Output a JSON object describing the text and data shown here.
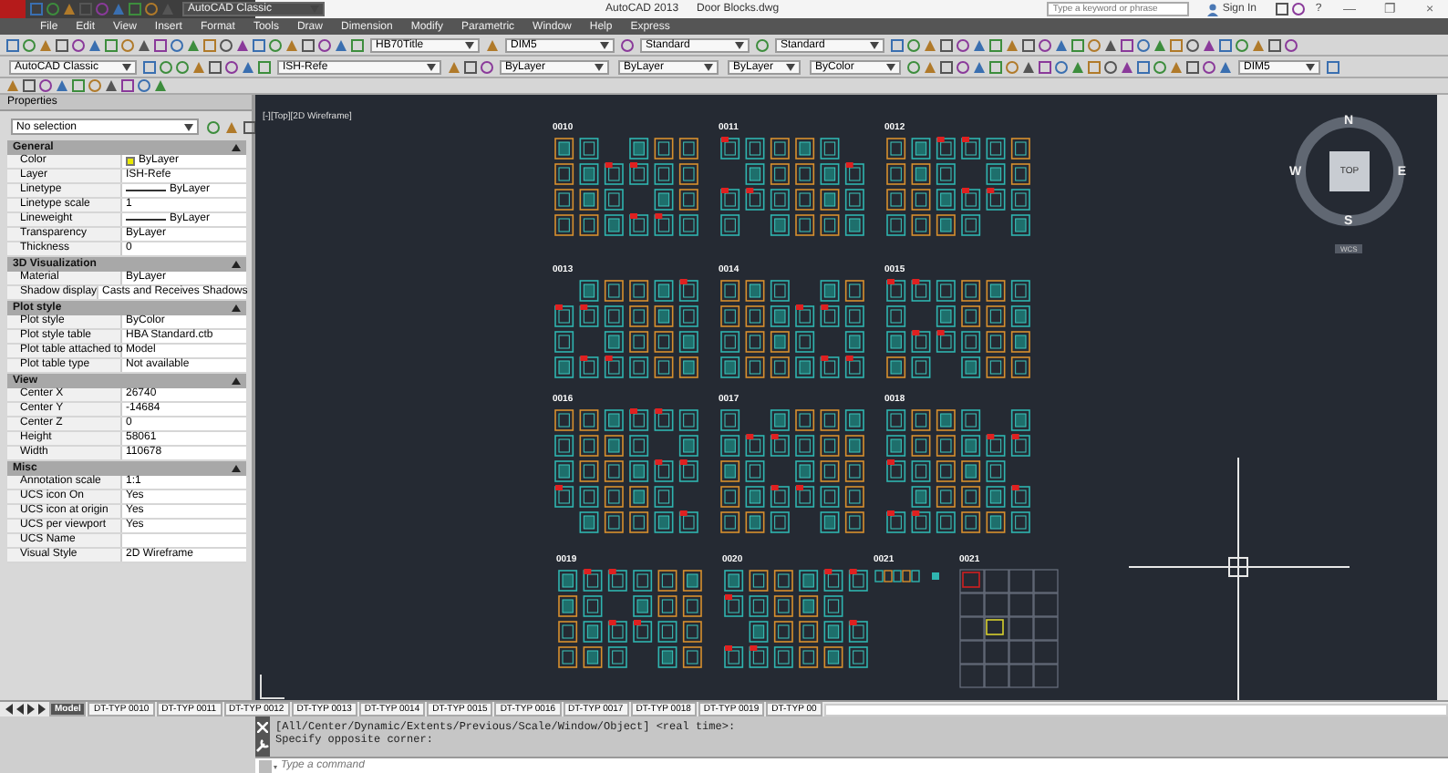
{
  "title_bar": {
    "workspace": "AutoCAD Classic",
    "app_title": "AutoCAD 2013",
    "file_name": "Door Blocks.dwg",
    "search": {
      "placeholder": "Type a keyword or phrase"
    },
    "sign_in": "Sign In",
    "help": "?",
    "window_controls": [
      "—",
      "❐",
      "×"
    ]
  },
  "menu_bar": [
    "File",
    "Edit",
    "View",
    "Insert",
    "Format",
    "Tools",
    "Draw",
    "Dimension",
    "Modify",
    "Parametric",
    "Window",
    "Help",
    "Express"
  ],
  "toolbar_1": {
    "dropdowns": [
      "HB70Title",
      "DIM5",
      "Standard",
      "Standard"
    ]
  },
  "toolbar_2": {
    "dropdowns": [
      "AutoCAD Classic",
      "ISH-Refe",
      "ByLayer",
      "ByLayer",
      "ByLayer",
      "ByColor",
      "DIM5"
    ]
  },
  "properties": {
    "title": "Properties",
    "selection": "No selection",
    "sections": [
      {
        "title": "General",
        "expanded": true,
        "rows": [
          {
            "label": "Color",
            "value": "ByLayer",
            "kind": "color"
          },
          {
            "label": "Layer",
            "value": "ISH-Refe",
            "kind": "text"
          },
          {
            "label": "Linetype",
            "value": "ByLayer",
            "kind": "line"
          },
          {
            "label": "Linetype scale",
            "value": "1",
            "kind": "text"
          },
          {
            "label": "Lineweight",
            "value": "ByLayer",
            "kind": "line"
          },
          {
            "label": "Transparency",
            "value": "ByLayer",
            "kind": "text"
          },
          {
            "label": "Thickness",
            "value": "0",
            "kind": "text"
          }
        ]
      },
      {
        "title": "3D Visualization",
        "expanded": true,
        "rows": [
          {
            "label": "Material",
            "value": "ByLayer",
            "kind": "text"
          },
          {
            "label": "Shadow display",
            "value": "Casts and Receives Shadows",
            "kind": "text"
          }
        ]
      },
      {
        "title": "Plot style",
        "expanded": true,
        "rows": [
          {
            "label": "Plot style",
            "value": "ByColor",
            "kind": "text"
          },
          {
            "label": "Plot style table",
            "value": "HBA Standard.ctb",
            "kind": "text"
          },
          {
            "label": "Plot table attached to",
            "value": "Model",
            "kind": "text"
          },
          {
            "label": "Plot table type",
            "value": "Not available",
            "kind": "text"
          }
        ]
      },
      {
        "title": "View",
        "expanded": true,
        "rows": [
          {
            "label": "Center X",
            "value": "26740",
            "kind": "text"
          },
          {
            "label": "Center Y",
            "value": "-14684",
            "kind": "text"
          },
          {
            "label": "Center Z",
            "value": "0",
            "kind": "text"
          },
          {
            "label": "Height",
            "value": "58061",
            "kind": "text"
          },
          {
            "label": "Width",
            "value": "110678",
            "kind": "text"
          }
        ]
      },
      {
        "title": "Misc",
        "expanded": true,
        "rows": [
          {
            "label": "Annotation scale",
            "value": "1:1",
            "kind": "text"
          },
          {
            "label": "UCS icon On",
            "value": "Yes",
            "kind": "text"
          },
          {
            "label": "UCS icon at origin",
            "value": "Yes",
            "kind": "text"
          },
          {
            "label": "UCS per viewport",
            "value": "Yes",
            "kind": "text"
          },
          {
            "label": "UCS Name",
            "kind": "text"
          },
          {
            "label": "Visual Style",
            "value": "2D Wireframe",
            "kind": "text"
          }
        ]
      }
    ]
  },
  "viewport": {
    "label": "[-][Top][2D Wireframe]",
    "viewcube": {
      "top": "TOP",
      "north": "N",
      "south": "S",
      "east": "E",
      "west": "W",
      "wcs": "WCS"
    },
    "blocks": [
      {
        "label": "0010",
        "kind": "doors"
      },
      {
        "label": "0011",
        "kind": "doors"
      },
      {
        "label": "0012",
        "kind": "doors"
      },
      {
        "label": "0013",
        "kind": "doors"
      },
      {
        "label": "0014",
        "kind": "doors"
      },
      {
        "label": "0015",
        "kind": "doors"
      },
      {
        "label": "0016",
        "kind": "doors"
      },
      {
        "label": "0017",
        "kind": "doors"
      },
      {
        "label": "0018",
        "kind": "doors"
      },
      {
        "label": "0019",
        "kind": "doors"
      },
      {
        "label": "0020",
        "kind": "doors"
      },
      {
        "label": "0021",
        "kind": "strip"
      },
      {
        "label": "0021",
        "kind": "grid"
      }
    ]
  },
  "layout_tabs": [
    {
      "label": "Model",
      "selected": true
    },
    {
      "label": "DT-TYP 0010",
      "selected": false
    },
    {
      "label": "DT-TYP 0011",
      "selected": false
    },
    {
      "label": "DT-TYP 0012",
      "selected": false
    },
    {
      "label": "DT-TYP 0013",
      "selected": false
    },
    {
      "label": "DT-TYP 0014",
      "selected": false
    },
    {
      "label": "DT-TYP 0015",
      "selected": false
    },
    {
      "label": "DT-TYP 0016",
      "selected": false
    },
    {
      "label": "DT-TYP 0017",
      "selected": false
    },
    {
      "label": "DT-TYP 0018",
      "selected": false
    },
    {
      "label": "DT-TYP 0019",
      "selected": false
    },
    {
      "label": "DT-TYP 00",
      "selected": false
    }
  ],
  "command_line": {
    "history": [
      "[All/Center/Dynamic/Extents/Previous/Scale/Window/Object] <real time>:",
      "Specify opposite corner:"
    ],
    "input": {
      "placeholder": "Type a command"
    }
  }
}
